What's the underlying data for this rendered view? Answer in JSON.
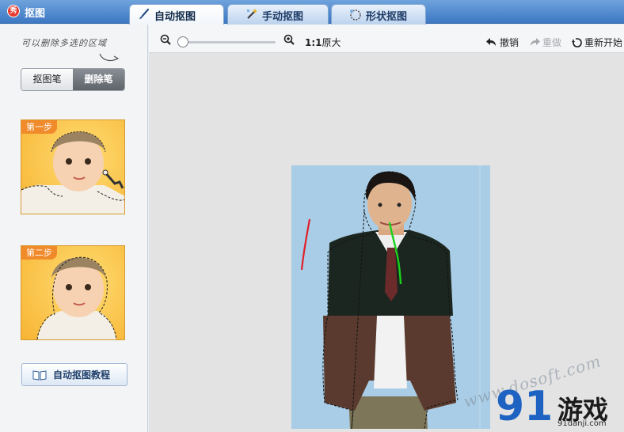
{
  "window": {
    "title": "抠图",
    "logo_text": "秀"
  },
  "tabs": [
    {
      "label": "自动抠图",
      "active": true,
      "icon": "brush-icon"
    },
    {
      "label": "手动抠图",
      "active": false,
      "icon": "magic-wand-icon"
    },
    {
      "label": "形状抠图",
      "active": false,
      "icon": "shape-icon"
    }
  ],
  "left_panel": {
    "hint": "可以删除多选的区域",
    "pen_toggle": {
      "options": [
        "抠图笔",
        "删除笔"
      ],
      "selected": "删除笔"
    },
    "steps": [
      {
        "label": "第一步"
      },
      {
        "label": "第二步"
      }
    ],
    "tutorial_button": "自动抠图教程"
  },
  "toolbar": {
    "zoom_level": 0,
    "ratio_label": "1:1",
    "ratio_text": "原大",
    "undo": "撤销",
    "redo": "重做",
    "reset": "重新开始"
  },
  "watermark": {
    "text": "www.dosoft.com",
    "logo_num": "91",
    "logo_text": "游戏",
    "site": "91danji.com"
  },
  "colors": {
    "accent": "#3d78c3",
    "stroke_red": "#e0202a",
    "stroke_green": "#1bd11b",
    "photo_bg": "#a9cde6"
  }
}
